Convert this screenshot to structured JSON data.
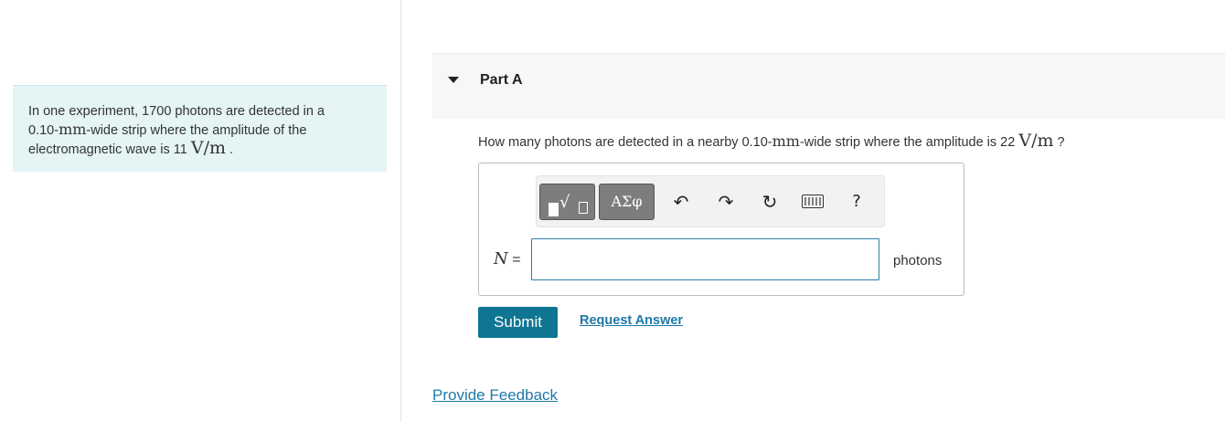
{
  "intro": {
    "line1": "In one experiment, 1700 photons are detected in a",
    "line2_pre": "0.10-",
    "line2_unit": "mm",
    "line2_post": "-wide strip where the amplitude of the",
    "line3_pre": "electromagnetic wave is 11 ",
    "line3_unit": "V/m",
    "line3_post": " ."
  },
  "part": {
    "title": "Part A"
  },
  "question": {
    "pre": "How many photons are detected in a nearby 0.10-",
    "unit1": "mm",
    "mid": "-wide strip where the amplitude is 22 ",
    "unit2": "V/m",
    "post": " ?"
  },
  "toolbar": {
    "symbols_label": "ΑΣφ",
    "undo_glyph": "↶",
    "redo_glyph": "↷",
    "reset_glyph": "↻",
    "help_label": "?"
  },
  "answer": {
    "variable": "N",
    "equals": " =",
    "value": "",
    "unit": "photons"
  },
  "actions": {
    "submit_label": "Submit",
    "request_label": "Request Answer",
    "feedback_label": "Provide Feedback"
  },
  "colors": {
    "intro_bg": "#e5f4f5",
    "accent": "#0e7693",
    "link": "#1e79a8"
  }
}
